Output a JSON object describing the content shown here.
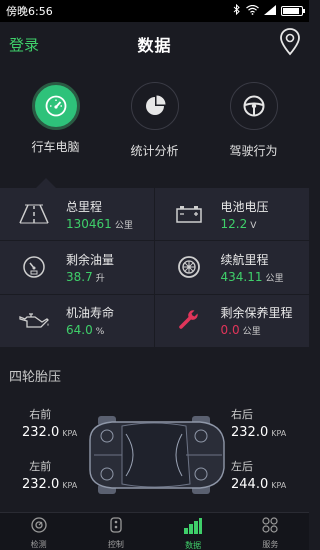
{
  "status_bar": {
    "time": "傍晚6:56"
  },
  "header": {
    "login": "登录",
    "title": "数据",
    "location_icon": "location-pin-icon"
  },
  "modes": [
    {
      "label": "行车电脑",
      "icon": "speedometer-icon",
      "active": true
    },
    {
      "label": "统计分析",
      "icon": "pie-chart-icon",
      "active": false
    },
    {
      "label": "驾驶行为",
      "icon": "steering-wheel-icon",
      "active": false
    }
  ],
  "stats": {
    "mileage": {
      "label": "总里程",
      "value": "130461",
      "unit": "公里"
    },
    "battery": {
      "label": "电池电压",
      "value": "12.2",
      "unit": "V"
    },
    "fuel": {
      "label": "剩余油量",
      "value": "38.7",
      "unit": "升"
    },
    "range": {
      "label": "续航里程",
      "value": "434.11",
      "unit": "公里"
    },
    "oil_life": {
      "label": "机油寿命",
      "value": "64.0",
      "unit": "%"
    },
    "maintenance": {
      "label": "剩余保养里程",
      "value": "0.0",
      "unit": "公里"
    }
  },
  "tire_pressure": {
    "title": "四轮胎压",
    "front_right": {
      "label": "右前",
      "value": "232.0",
      "unit": "KPA"
    },
    "rear_right": {
      "label": "右后",
      "value": "232.0",
      "unit": "KPA"
    },
    "front_left": {
      "label": "左前",
      "value": "232.0",
      "unit": "KPA"
    },
    "rear_left": {
      "label": "左后",
      "value": "244.0",
      "unit": "KPA"
    }
  },
  "tabs": [
    {
      "label": "检测",
      "active": false
    },
    {
      "label": "控制",
      "active": false
    },
    {
      "label": "数据",
      "active": true
    },
    {
      "label": "服务",
      "active": false
    }
  ],
  "colors": {
    "accent": "#3fcf6a",
    "warning": "#e0355a",
    "background": "#1a1b22",
    "panel": "#252631"
  }
}
